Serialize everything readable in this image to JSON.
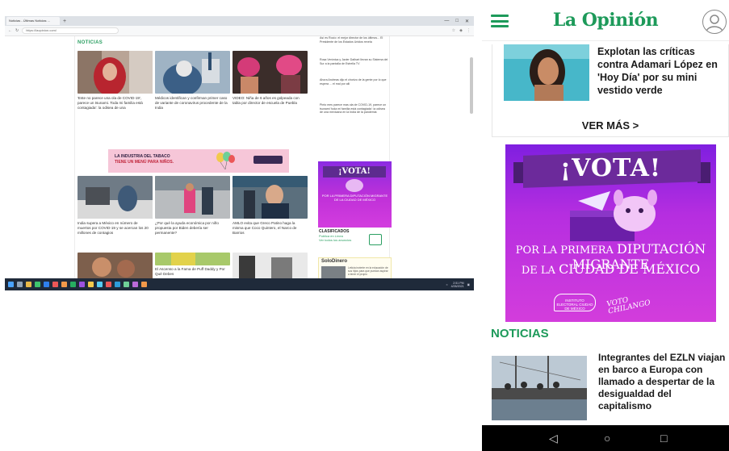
{
  "desktop": {
    "browser": {
      "tab_title": "Noticias - Últimas Noticias ...",
      "url": "https://laopinion.com/",
      "tab_plus": "+"
    },
    "section_label": "NOTICIAS",
    "articles": [
      {
        "text": "'Este no parece una ola de COVID-19', parece un tsunami. Toda mi familia está contagiada': la odisea de una"
      },
      {
        "text": "Médicos identifican y confirman primer caso de variante de coronavirus procedente de la India"
      },
      {
        "text": "VIDEO: Niña de 6 años es golpeada con tabla por director de escuela de Puebla"
      },
      {
        "text": "India supera a México en número de muertos por COVID-19 y se acercan los 20 millones de contagios"
      },
      {
        "text": "¿Por qué la ayuda económica por niño propuesta por Biden debería ser permanente?"
      },
      {
        "text": "AMLO evita que Greco Patino haga la misma que Coco Quintero, el Narco de Barrios"
      },
      {
        "text": "El Ascenso a la Fama de Puff Daddy y Por Qué Debes"
      }
    ],
    "sidebar": [
      {
        "text": "Así es Rocío: el mejor director de los últimos... El Presidente de los Estados Unidos revela"
      },
      {
        "text": "Rosa Verónica y Javier Dalhart llevan su Sistema del Sur a la pantalla de Estrella TV"
      },
      {
        "text": "Ahora Andreas dijo el chorizo de la gente por lo que espera ... el mal por allí"
      },
      {
        "text": "Pinto mes parece mas ola de COVID-19, parece un tsunami 'toda mi familia está contagiada': la odisea de una mexicana en la India de la pandemia"
      }
    ],
    "ad_tabaco": {
      "line1": "LA INDUSTRIA DEL TABACO",
      "line2": "TIENE UN MENÚ PARA NIÑOS."
    },
    "vota_small": {
      "title": "¡VOTA!",
      "subtitle": "POR LA PRIMERA DIPUTACIÓN MIGRANTE DE LA CIUDAD DE MÉXICO"
    },
    "clasificados": {
      "title": "CLASIFICADOS",
      "line1": "Publica en Línea",
      "line2": "Ver todos los anuncios"
    },
    "solodinero": {
      "title": "SoloDinero",
      "text": "Leticia invierte en la educación de sus hijos para que puedan aspirar a tener el propio"
    },
    "taskbar_clock": {
      "time": "2:51 PM",
      "date": "4/26/2021"
    }
  },
  "phone": {
    "logo": "La Opinión",
    "article_top": {
      "title": "Explotan las críticas contra Adamari López en 'Hoy Día' por su mini vestido verde"
    },
    "ver_mas": "VER MÁS >",
    "vota_ad": {
      "title": "¡VOTA!",
      "line1_prefix": "POR LA PRIMERA ",
      "line1_big": "DIPUTACIÓN MIGRANTE",
      "line2_prefix": "DE LA ",
      "line2_big": "CIUDAD DE MÉXICO",
      "logo_a": "INSTITUTO ELECTORAL CIUDAD DE MÉXICO",
      "logo_b": "VOTO CHILANGO"
    },
    "section_label": "NOTICIAS",
    "article_news": {
      "title": "Integrantes del EZLN viajan en barco a Europa con llamado a despertar de la desigualdad del capitalismo"
    },
    "nav": {
      "back": "◁",
      "home": "○",
      "recents": "□"
    }
  }
}
